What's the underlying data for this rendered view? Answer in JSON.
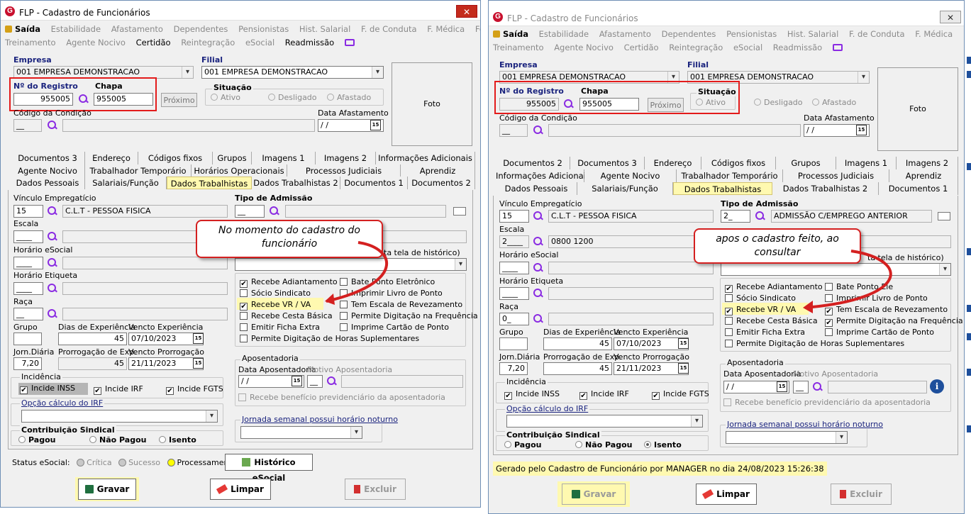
{
  "window_title": "FLP - Cadastro de Funcionários",
  "close_glyph": "✕",
  "app_logo": "G",
  "menu": {
    "exit": "Saída",
    "row1": [
      "Estabilidade",
      "Afastamento",
      "Dependentes",
      "Pensionistas",
      "Hist. Salarial",
      "F. de Conduta",
      "F. Médica",
      "Férias"
    ],
    "row2a": [
      "Treinamento",
      "Agente Nocivo"
    ],
    "certidao": "Certidão",
    "row2b": [
      "Reintegração",
      "eSocial",
      "Readmissão"
    ]
  },
  "labels": {
    "empresa": "Empresa",
    "filial": "Filial",
    "nregistro": "Nº do Registro",
    "chapa": "Chapa",
    "situacao": "Situação",
    "ativo": "Ativo",
    "desligado": "Desligado",
    "afastado": "Afastado",
    "proximo": "Próximo",
    "foto": "Foto",
    "codigo_condicao": "Código da Condição",
    "data_afastamento": "Data Afastamento",
    "vinculo": "Vínculo Empregatício",
    "tipo_admissao": "Tipo de Admissão",
    "escala": "Escala",
    "horario_esocial": "Horário eSocial",
    "horario_etiqueta": "Horário Etiqueta",
    "raca": "Raça",
    "grupo": "Grupo",
    "dias_experiencia": "Dias de Experiência",
    "vencto_experiencia": "Vencto Experiência",
    "jorn_diaria": "Jorn.Diária",
    "prorrogacao": "Prorrogação de Exp.",
    "vencto_prorrogacao": "Vencto Prorrogação",
    "incidencia": "Incidência",
    "incide_inss": "Incide INSS",
    "incide_irf": "Incide IRF",
    "incide_fgts": "Incide FGTS",
    "opcao_irf": "Opção cálculo do IRF",
    "contrib_sindical": "Contribuição Sindical",
    "pagou": "Pagou",
    "nao_pagou": "Não Pagou",
    "isento": "Isento",
    "aposentadoria": "Aposentadoria",
    "data_aposentadoria": "Data Aposentadoria",
    "motivo_aposentadoria": "Motivo Aposentadoria",
    "recebe_beneficio": "Recebe benefício previdenciário da aposentadoria",
    "jornada_noturno": "Jornada semanal possui horário noturno",
    "historico_partial": "ta tela de histórico)",
    "status_esocial": "Status eSocial:",
    "critica": "Crítica",
    "sucesso": "Sucesso",
    "processamento": "Processamento",
    "historico_esocial": "Histórico eSocial",
    "gravar": "Gravar",
    "limpar": "Limpar",
    "excluir": "Excluir"
  },
  "checkboxes": {
    "left_col": [
      "Recebe Adiantamento",
      "Sócio Sindicato",
      "Recebe VR / VA",
      "Recebe Cesta Básica",
      "Emitir Ficha Extra",
      "Permite Digitação de Horas Suplementares"
    ],
    "right_col1": [
      "Bate Ponto Eletrônico",
      "Imprimir Livro de Ponto",
      "Tem Escala de Revezamento",
      "Permite Digitação na Frequência",
      "Imprime Cartão de Ponto"
    ],
    "right_col2": [
      "Bate Ponto Ele",
      "Imprimir Livro de Ponto",
      "Tem Escala de Revezamento",
      "Permite Digitação na Frequência",
      "Imprime Cartão de Ponto"
    ],
    "check_mark": "✔"
  },
  "values": {
    "empresa": "001 EMPRESA DEMONSTRACAO",
    "filial": "001 EMPRESA DEMONSTRACAO",
    "registro": "955005",
    "chapa": "955005",
    "codigo_condicao": "__",
    "data_afastamento": "/ /",
    "vinculo_code": "15",
    "vinculo_desc": "C.L.T - PESSOA FISICA",
    "tipo_admissao_code_left": "__",
    "tipo_admissao_code_right": "2_",
    "tipo_admissao_desc_right": "ADMISSÃO C/EMPREGO ANTERIOR",
    "escala_left": "____",
    "escala_right": "2____",
    "escala_desc_right": "0800 1200",
    "horario_esocial": "____",
    "horario_etiqueta": "____",
    "raca_left": "__",
    "raca_right": "0_",
    "dias_experiencia": "45",
    "vencto_experiencia": "07/10/2023",
    "jorn_diaria": "7,20",
    "prorrogacao": "45",
    "vencto_prorrogacao": "21/11/2023",
    "data_aposentadoria": "/ /",
    "motivo_code": "__",
    "cal_glyph": "15"
  },
  "tabs_left": {
    "row1": [
      "Documentos 3",
      "Endereço",
      "Códigos fixos",
      "Grupos",
      "Imagens 1",
      "Imagens 2",
      "Informações Adicionais"
    ],
    "row2": [
      "Agente Nocivo",
      "Trabalhador Temporário",
      "Horários Operacionais",
      "Processos Judiciais",
      "Aprendiz"
    ],
    "row3": [
      "Dados Pessoais",
      "Salariais/Função",
      "Dados Trabalhistas",
      "Dados Trabalhistas 2",
      "Documentos 1",
      "Documentos 2"
    ]
  },
  "tabs_right": {
    "row1": [
      "Documentos 2",
      "Documentos 3",
      "Endereço",
      "Códigos fixos",
      "Grupos",
      "Imagens 1",
      "Imagens 2"
    ],
    "row2": [
      "Informações Adicionais",
      "Agente Nocivo",
      "Trabalhador Temporário",
      "Processos Judiciais",
      "Aprendiz"
    ],
    "row3": [
      "Dados Pessoais",
      "Salariais/Função",
      "Dados Trabalhistas",
      "Dados Trabalhistas 2",
      "Documentos 1"
    ]
  },
  "callouts": {
    "left": "No momento do cadastro do funcionário",
    "right": "apos o cadastro feito, ao consultar"
  },
  "status_message": "Gerado pelo Cadastro de Funcionário por MANAGER no dia 24/08/2023 15:26:38"
}
